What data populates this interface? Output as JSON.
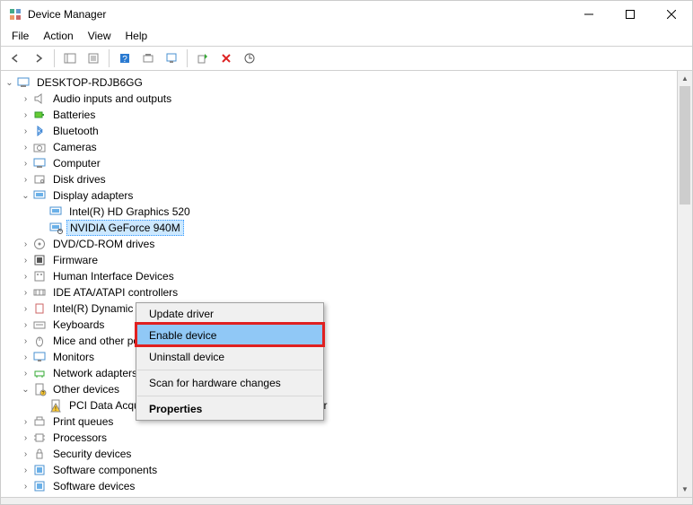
{
  "window": {
    "title": "Device Manager"
  },
  "menu": {
    "file": "File",
    "action": "Action",
    "view": "View",
    "help": "Help"
  },
  "tree": {
    "root": "DESKTOP-RDJB6GG",
    "nodes": [
      {
        "label": "Audio inputs and outputs",
        "icon": "speaker"
      },
      {
        "label": "Batteries",
        "icon": "battery"
      },
      {
        "label": "Bluetooth",
        "icon": "bluetooth"
      },
      {
        "label": "Cameras",
        "icon": "camera"
      },
      {
        "label": "Computer",
        "icon": "computer"
      },
      {
        "label": "Disk drives",
        "icon": "disk"
      },
      {
        "label": "Display adapters",
        "icon": "display",
        "expanded": true
      },
      {
        "label": "DVD/CD-ROM drives",
        "icon": "cd"
      },
      {
        "label": "Firmware",
        "icon": "firmware"
      },
      {
        "label": "Human Interface Devices",
        "icon": "hid"
      },
      {
        "label": "IDE ATA/ATAPI controllers",
        "icon": "ide"
      },
      {
        "label": "Intel(R) Dynamic Platform and Thermal Framework",
        "icon": "thermal"
      },
      {
        "label": "Keyboards",
        "icon": "keyboard"
      },
      {
        "label": "Mice and other pointing devices",
        "icon": "mouse"
      },
      {
        "label": "Monitors",
        "icon": "monitor"
      },
      {
        "label": "Network adapters",
        "icon": "network"
      },
      {
        "label": "Other devices",
        "icon": "other",
        "expanded": true
      },
      {
        "label": "Print queues",
        "icon": "printer"
      },
      {
        "label": "Processors",
        "icon": "processor"
      },
      {
        "label": "Security devices",
        "icon": "security"
      },
      {
        "label": "Software components",
        "icon": "software"
      },
      {
        "label": "Software devices",
        "icon": "software"
      }
    ],
    "display_children": [
      {
        "label": "Intel(R) HD Graphics 520"
      },
      {
        "label": "NVIDIA GeForce 940M",
        "selected": true
      }
    ],
    "other_children": [
      {
        "label": "PCI Data Acquisition and Signal Processing Controller"
      }
    ]
  },
  "context_menu": {
    "update": "Update driver",
    "enable": "Enable device",
    "uninstall": "Uninstall device",
    "scan": "Scan for hardware changes",
    "properties": "Properties"
  }
}
